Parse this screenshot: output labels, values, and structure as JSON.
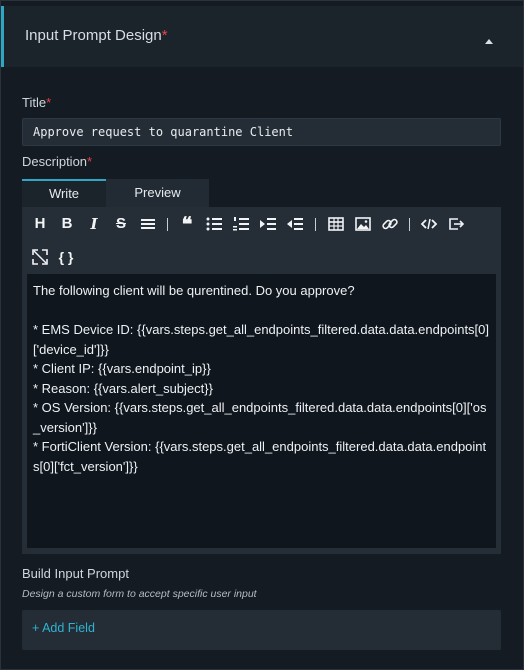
{
  "section": {
    "title": "Input Prompt Design",
    "required_mark": "*"
  },
  "title_field": {
    "label": "Title",
    "required_mark": "*",
    "value": "Approve request to quarantine Client"
  },
  "description": {
    "label": "Description",
    "required_mark": "*",
    "tabs": [
      {
        "label": "Write",
        "active": true
      },
      {
        "label": "Preview",
        "active": false
      }
    ],
    "toolbar": [
      "heading-icon",
      "bold-icon",
      "italic-icon",
      "strikethrough-icon",
      "horizontal-rule-icon",
      "quote-icon",
      "bullet-list-icon",
      "numbered-list-icon",
      "indent-icon",
      "outdent-icon",
      "table-icon",
      "image-icon",
      "link-icon",
      "code-icon",
      "insert-icon",
      "fullscreen-icon",
      "variable-icon"
    ],
    "text": "The following client will be qurentined. Do you approve?\n\n* EMS Device ID: {{vars.steps.get_all_endpoints_filtered.data.data.endpoints[0]['device_id']}}\n* Client IP: {{vars.endpoint_ip}}\n* Reason: {{vars.alert_subject}}\n* OS Version: {{vars.steps.get_all_endpoints_filtered.data.data.endpoints[0]['os_version']}}\n* FortiClient Version: {{vars.steps.get_all_endpoints_filtered.data.data.endpoints[0]['fct_version']}}"
  },
  "build": {
    "label": "Build Input Prompt",
    "hint": "Design a custom form to accept specific user input",
    "add_field": "+ Add Field"
  },
  "colors": {
    "accent": "#2fa7c4",
    "required": "#e8434c",
    "panel_bg": "#141b22"
  }
}
